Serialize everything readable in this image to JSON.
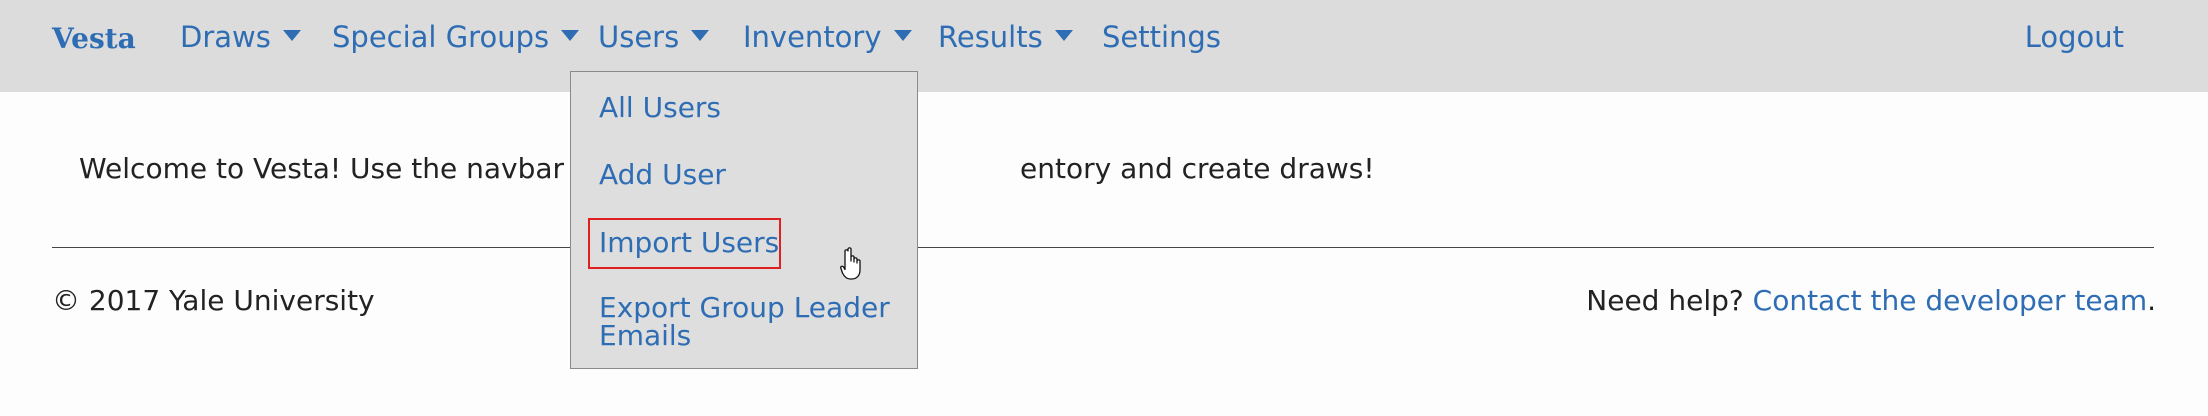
{
  "navbar": {
    "brand": "Vesta",
    "items": [
      {
        "label": "Draws",
        "has_caret": true
      },
      {
        "label": "Special Groups",
        "has_caret": true
      },
      {
        "label": "Users",
        "has_caret": true
      },
      {
        "label": "Inventory",
        "has_caret": true
      },
      {
        "label": "Results",
        "has_caret": true
      },
      {
        "label": "Settings",
        "has_caret": false
      }
    ],
    "logout": "Logout"
  },
  "users_menu": {
    "items": [
      {
        "label": "All Users"
      },
      {
        "label": "Add User"
      },
      {
        "label": "Import Users",
        "highlighted": true
      },
      {
        "label": "Export Group Leader Emails"
      }
    ]
  },
  "main": {
    "welcome_visible_left": "Welcome to Vesta! Use the navbar abo",
    "welcome_visible_right": "entory and create draws!"
  },
  "footer": {
    "copyright": "© 2017 Yale University",
    "help_prefix": "Need help? ",
    "help_link": "Contact the developer team",
    "help_suffix": "."
  },
  "colors": {
    "link": "#2e6db4",
    "navbar_bg": "#dcdcdc",
    "highlight_border": "#e02020"
  },
  "icons": [
    "caret-down-icon",
    "hand-pointer-icon"
  ]
}
